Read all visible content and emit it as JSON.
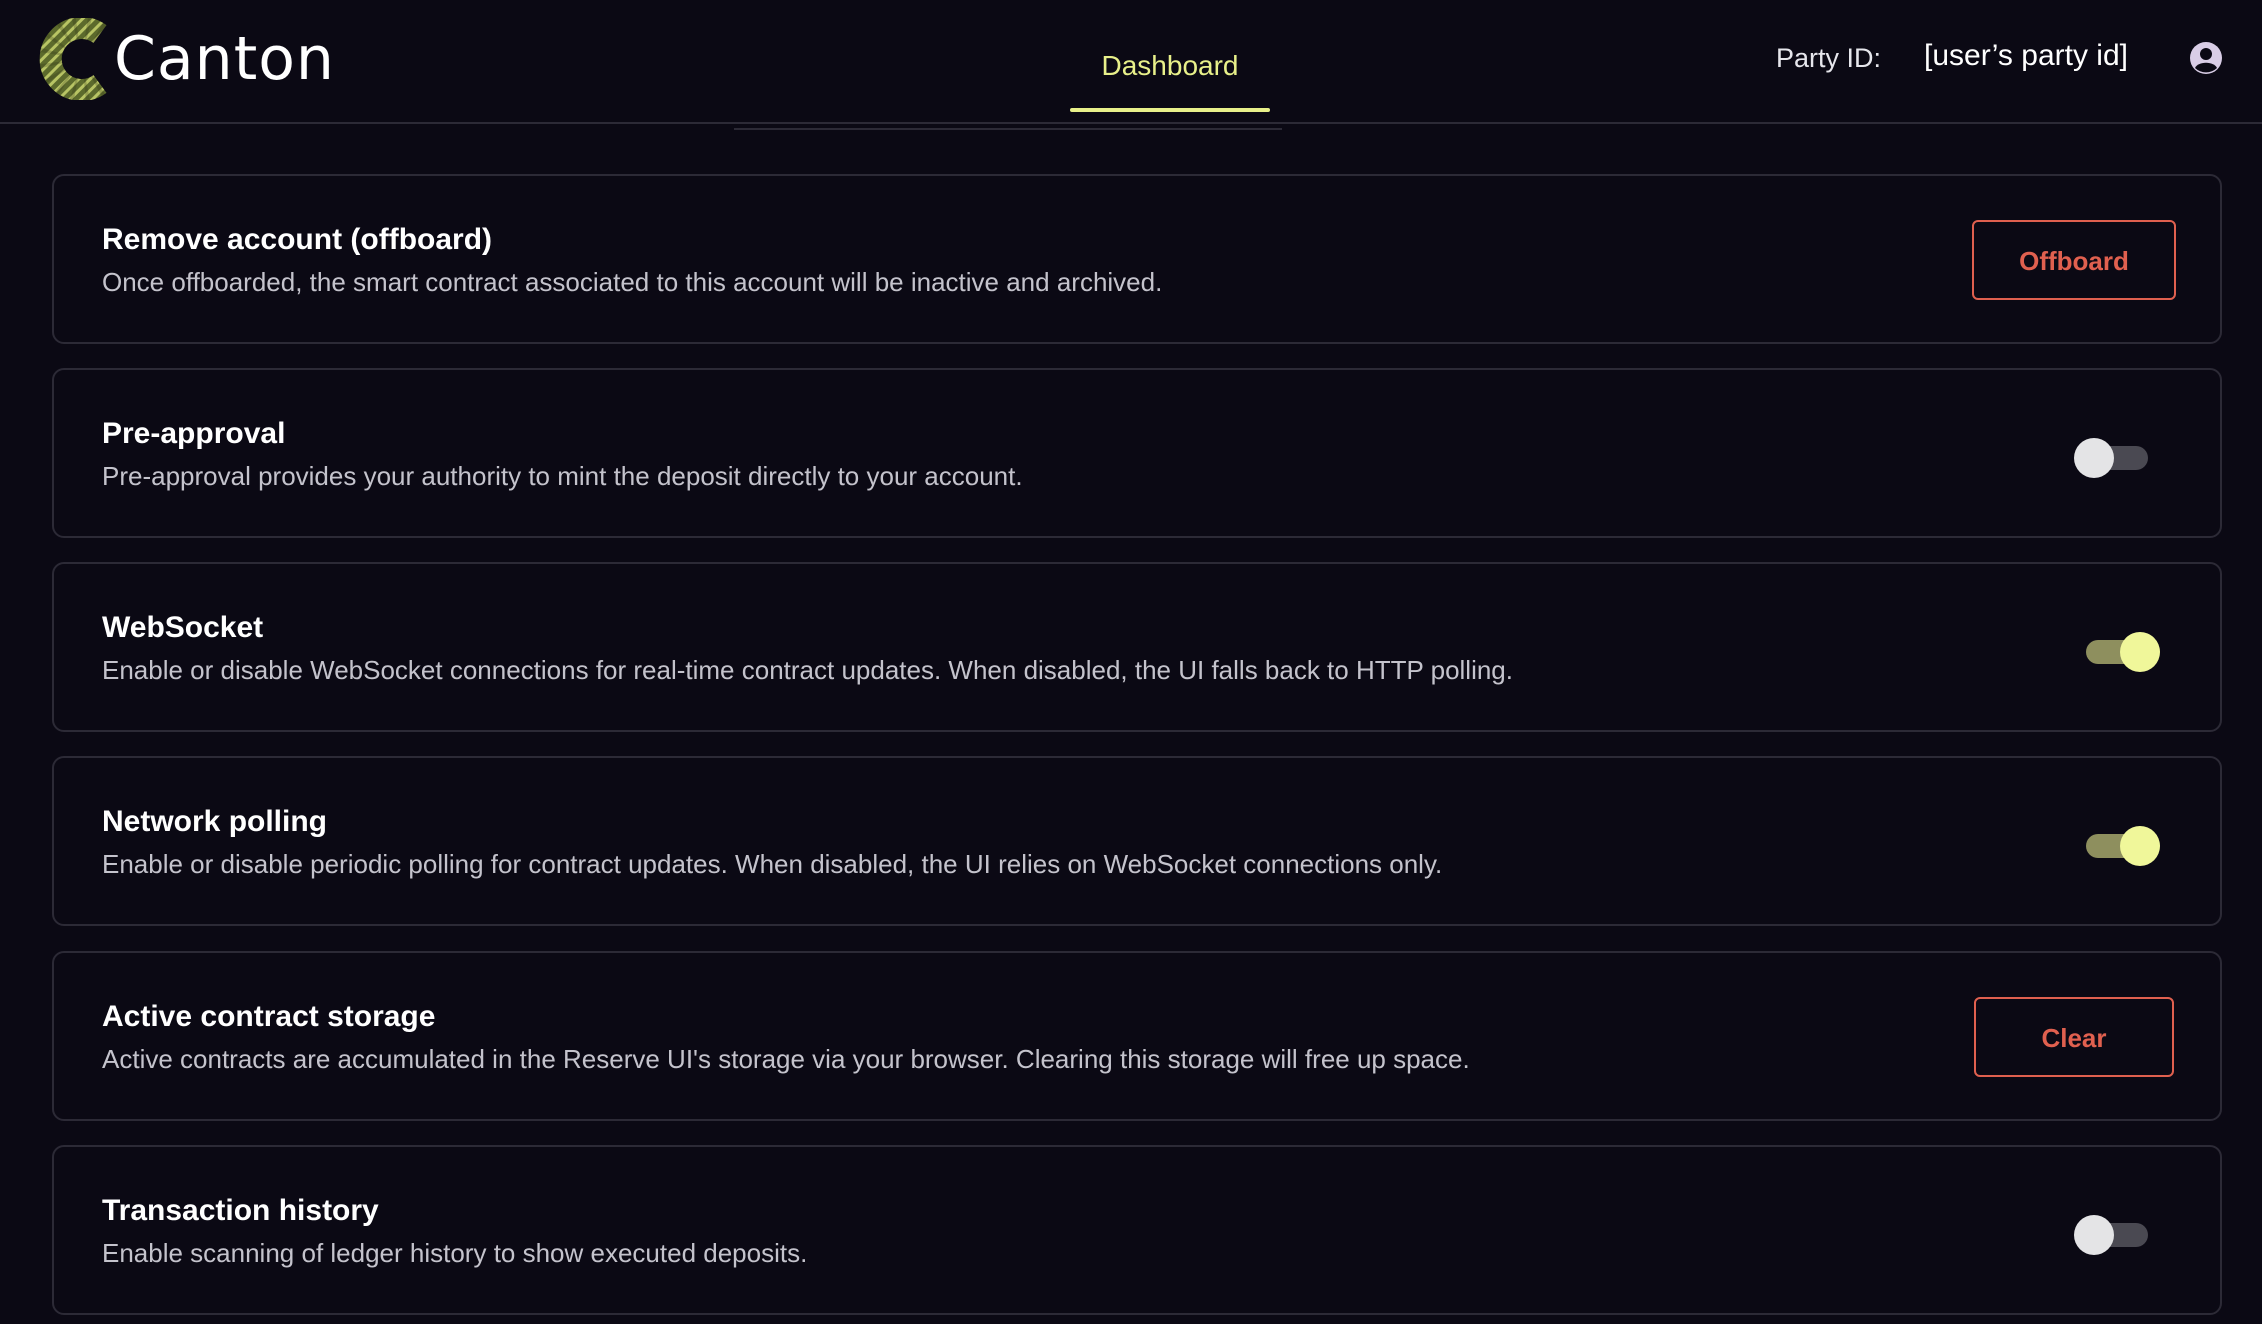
{
  "brand": {
    "name": "Canton"
  },
  "nav": {
    "tabs": [
      {
        "label": "Dashboard",
        "active": true
      }
    ]
  },
  "header": {
    "party_label": "Party ID:",
    "party_value": "[user’s party id]",
    "avatar_icon": "user-circle-icon"
  },
  "colors": {
    "background": "#0b0914",
    "accent": "#e8f08a",
    "danger": "#e0604f",
    "card_border": "#2c2a36"
  },
  "settings": [
    {
      "title": "Remove account (offboard)",
      "description": "Once offboarded, the smart contract associated to this account will be inactive and archived.",
      "control": "button",
      "button_label": "Offboard"
    },
    {
      "title": "Pre-approval",
      "description": "Pre-approval provides your authority to mint the deposit directly to your account.",
      "control": "toggle",
      "enabled": false
    },
    {
      "title": "WebSocket",
      "description": "Enable or disable WebSocket connections for real-time contract updates. When disabled, the UI falls back to HTTP polling.",
      "control": "toggle",
      "enabled": true
    },
    {
      "title": "Network polling",
      "description": "Enable or disable periodic polling for contract updates. When disabled, the UI relies on WebSocket connections only.",
      "control": "toggle",
      "enabled": true
    },
    {
      "title": "Active contract storage",
      "description": "Active contracts are accumulated in the Reserve UI's storage via your browser. Clearing this storage will free up space.",
      "control": "button",
      "button_label": "Clear"
    },
    {
      "title": "Transaction history",
      "description": "Enable scanning of ledger history to show executed deposits.",
      "control": "toggle",
      "enabled": false
    }
  ]
}
